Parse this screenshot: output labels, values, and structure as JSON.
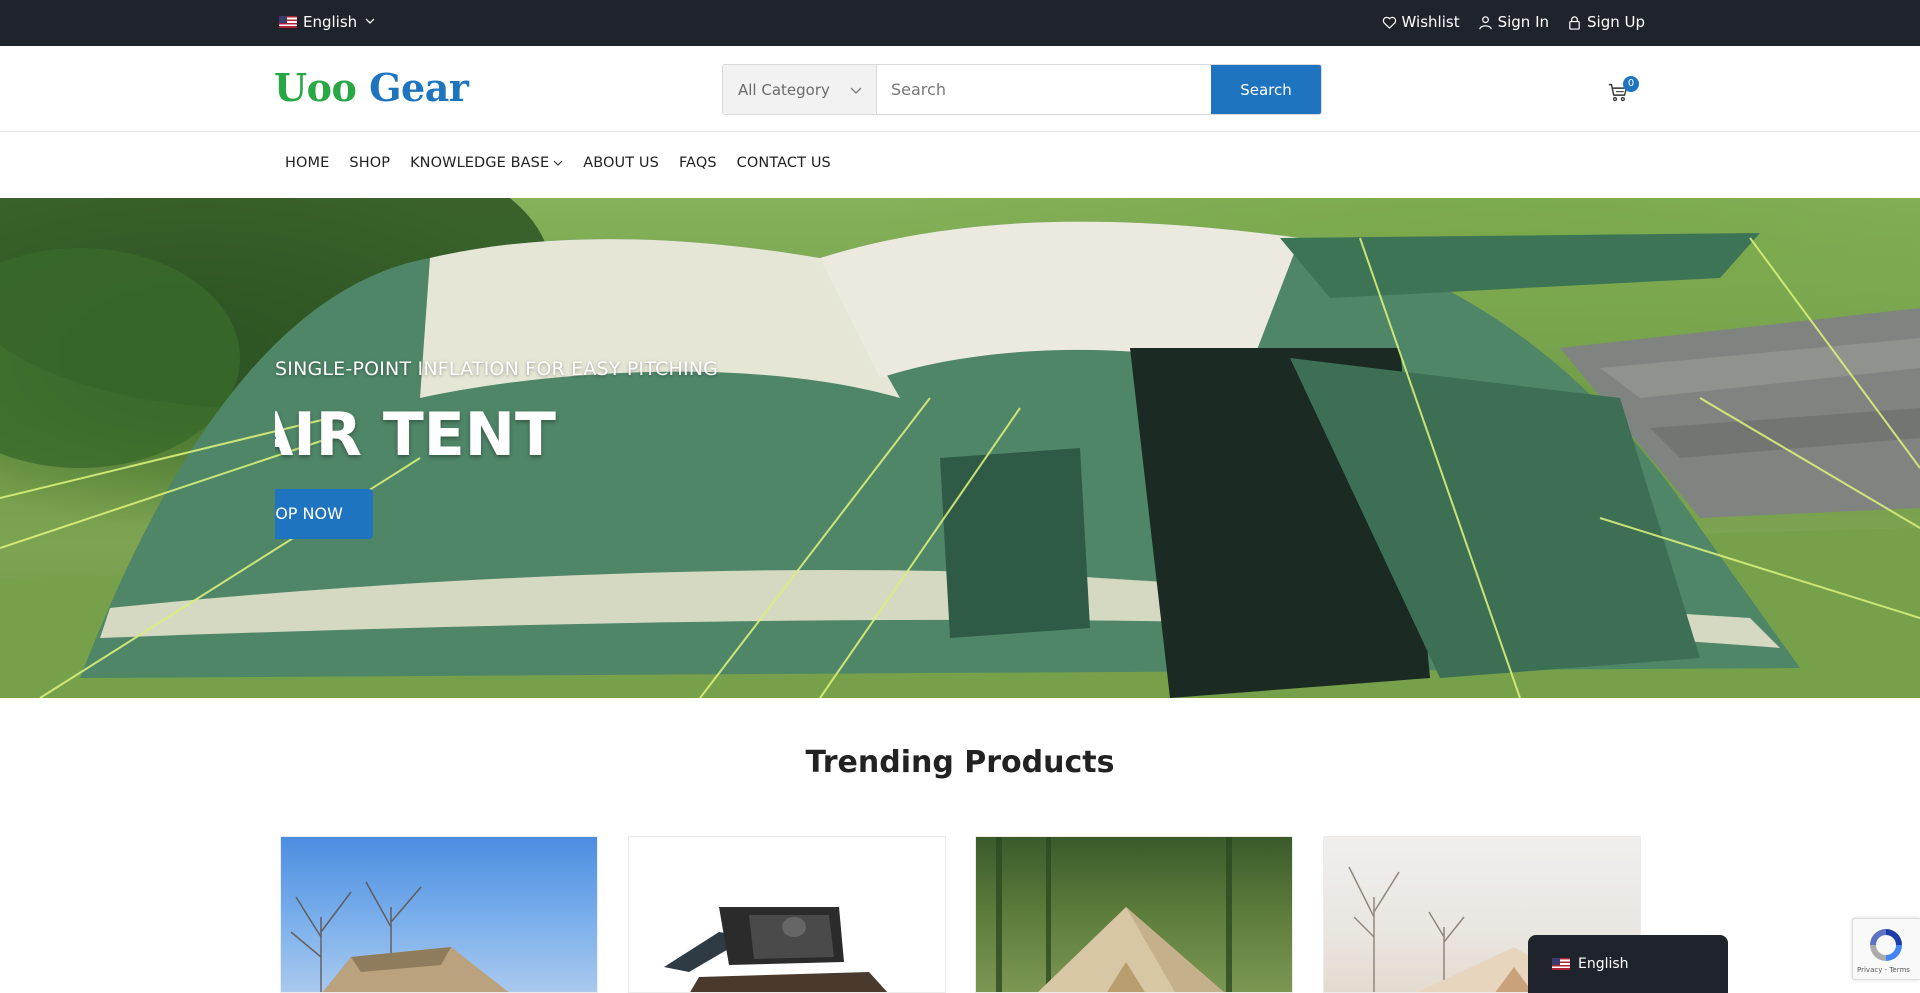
{
  "topbar": {
    "language": "English",
    "links": {
      "wishlist": "Wishlist",
      "signin": "Sign In",
      "signup": "Sign Up"
    }
  },
  "header": {
    "logo_part1": "Uoo",
    "logo_part2": "Gear",
    "category_select": "All Category",
    "search_placeholder": "Search",
    "search_button": "Search",
    "cart_count": "0"
  },
  "nav": {
    "items": [
      "HOME",
      "SHOP",
      "KNOWLEDGE BASE",
      "ABOUT US",
      "FAQS",
      "CONTACT US"
    ]
  },
  "hero": {
    "subtitle": "SINGLE-POINT INFLATION FOR EASY PITCHING",
    "title": "AIR TENT",
    "button": "SHOP NOW"
  },
  "trending": {
    "title": "Trending Products"
  },
  "floating_language": "English",
  "recaptcha": {
    "text": "Privacy - Terms"
  },
  "colors": {
    "topbar_bg": "#1f232b",
    "brand_blue": "#1f74c0",
    "brand_green": "#28a745"
  }
}
